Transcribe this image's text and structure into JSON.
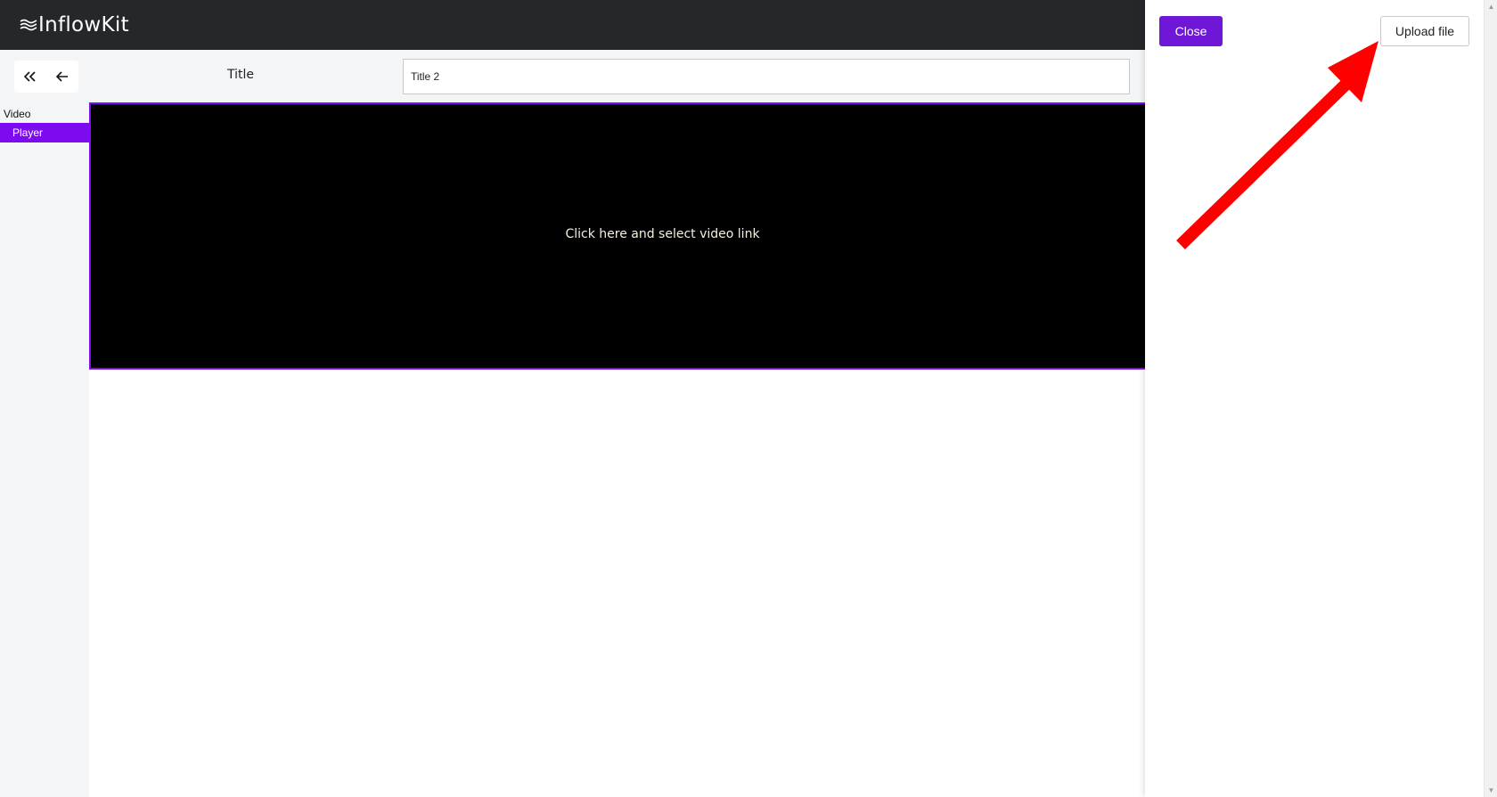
{
  "app": {
    "brand": "InflowKit"
  },
  "toolbar": {
    "collapse_icon": "double-chevron-left-icon",
    "back_icon": "arrow-left-icon",
    "title_label": "Title",
    "title_value": "Title 2"
  },
  "sidebar": {
    "group_label": "Video",
    "items": [
      {
        "label": "Player",
        "selected": true
      }
    ]
  },
  "player": {
    "placeholder": "Click here and select video link"
  },
  "panel": {
    "close_label": "Close",
    "upload_label": "Upload file"
  },
  "colors": {
    "accent": "#7c0bf0",
    "button_primary": "#6f17d6",
    "topbar": "#26272b",
    "annotation": "#ff0000"
  }
}
